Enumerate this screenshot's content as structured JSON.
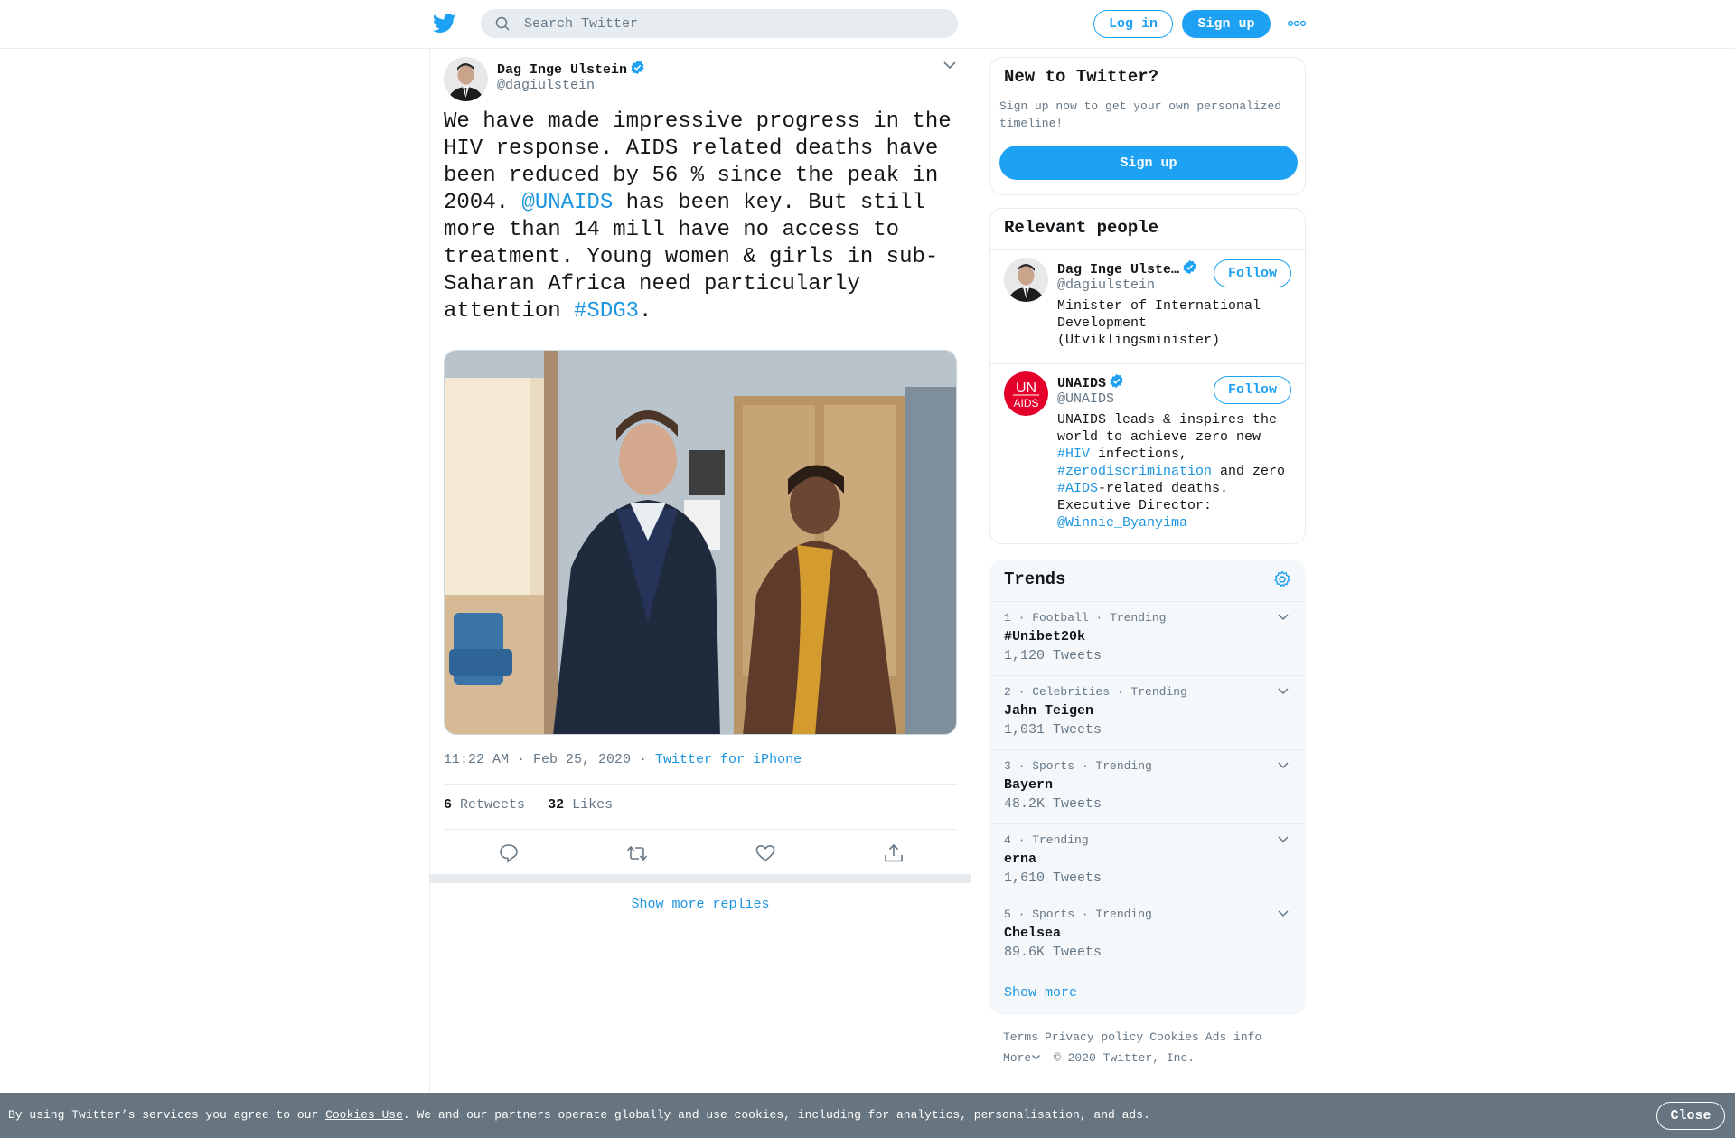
{
  "header": {
    "search_placeholder": "Search Twitter",
    "login_label": "Log in",
    "signup_label": "Sign up"
  },
  "tweet": {
    "author_name": "Dag Inge Ulstein",
    "author_handle": "@dagiulstein",
    "text_part1": "We have made impressive progress in the HIV response. AIDS related deaths have been reduced by 56 % since the peak in 2004. ",
    "mention": "@UNAIDS",
    "text_part2": " has been key. But still more than 14 mill have no access to treatment. Young women & girls in sub-Saharan Africa need particularly attention ",
    "hashtag": "#SDG3",
    "text_part3": ".",
    "timestamp": "11:22 AM · Feb 25, 2020 · ",
    "source": "Twitter for iPhone",
    "retweets_count": "6",
    "retweets_label": "Retweets",
    "likes_count": "32",
    "likes_label": "Likes",
    "show_more_replies": "Show more replies"
  },
  "new_to_twitter": {
    "title": "New to Twitter?",
    "subtitle": "Sign up now to get your own personalized timeline!",
    "signup_label": "Sign up"
  },
  "relevant_people": {
    "title": "Relevant people",
    "people": [
      {
        "name": "Dag Inge Ulste…",
        "handle": "@dagiulstein",
        "bio": "Minister of International Development (Utviklingsminister)",
        "follow_label": "Follow"
      },
      {
        "name": "UNAIDS",
        "handle": "@UNAIDS",
        "bio_p1": "UNAIDS leads & inspires the world to achieve zero new ",
        "bio_tag1": "#HIV",
        "bio_p2": " infections, ",
        "bio_tag2": "#zerodiscrimination",
        "bio_p3": " and zero ",
        "bio_tag3": "#AIDS",
        "bio_p4": "-related deaths. Executive Director: ",
        "bio_mention": "@Winnie_Byanyima",
        "follow_label": "Follow",
        "logo_text_top": "UN",
        "logo_text_bottom": "AIDS"
      }
    ]
  },
  "trends": {
    "title": "Trends",
    "items": [
      {
        "meta": "1 · Football · Trending",
        "name": "#Unibet20k",
        "count": "1,120 Tweets"
      },
      {
        "meta": "2 · Celebrities · Trending",
        "name": "Jahn Teigen",
        "count": "1,031 Tweets"
      },
      {
        "meta": "3 · Sports · Trending",
        "name": "Bayern",
        "count": "48.2K Tweets"
      },
      {
        "meta": "4 · Trending",
        "name": "erna",
        "count": "1,610 Tweets"
      },
      {
        "meta": "5 · Sports · Trending",
        "name": "Chelsea",
        "count": "89.6K Tweets"
      }
    ],
    "show_more": "Show more"
  },
  "footer": {
    "terms": "Terms",
    "privacy": "Privacy policy",
    "cookies": "Cookies",
    "ads_info": "Ads info",
    "more": "More",
    "copyright": "© 2020 Twitter, Inc."
  },
  "cookie_bar": {
    "text_before": "By using Twitter’s services you agree to our ",
    "link": "Cookies Use",
    "text_after": ". We and our partners operate globally and use cookies, including for analytics, personalisation, and ads.",
    "close_label": "Close"
  },
  "colors": {
    "accent": "#1da1f2",
    "link": "#1b95e0",
    "unaids_red": "#e4002b",
    "cookie_bg": "#66757f"
  }
}
